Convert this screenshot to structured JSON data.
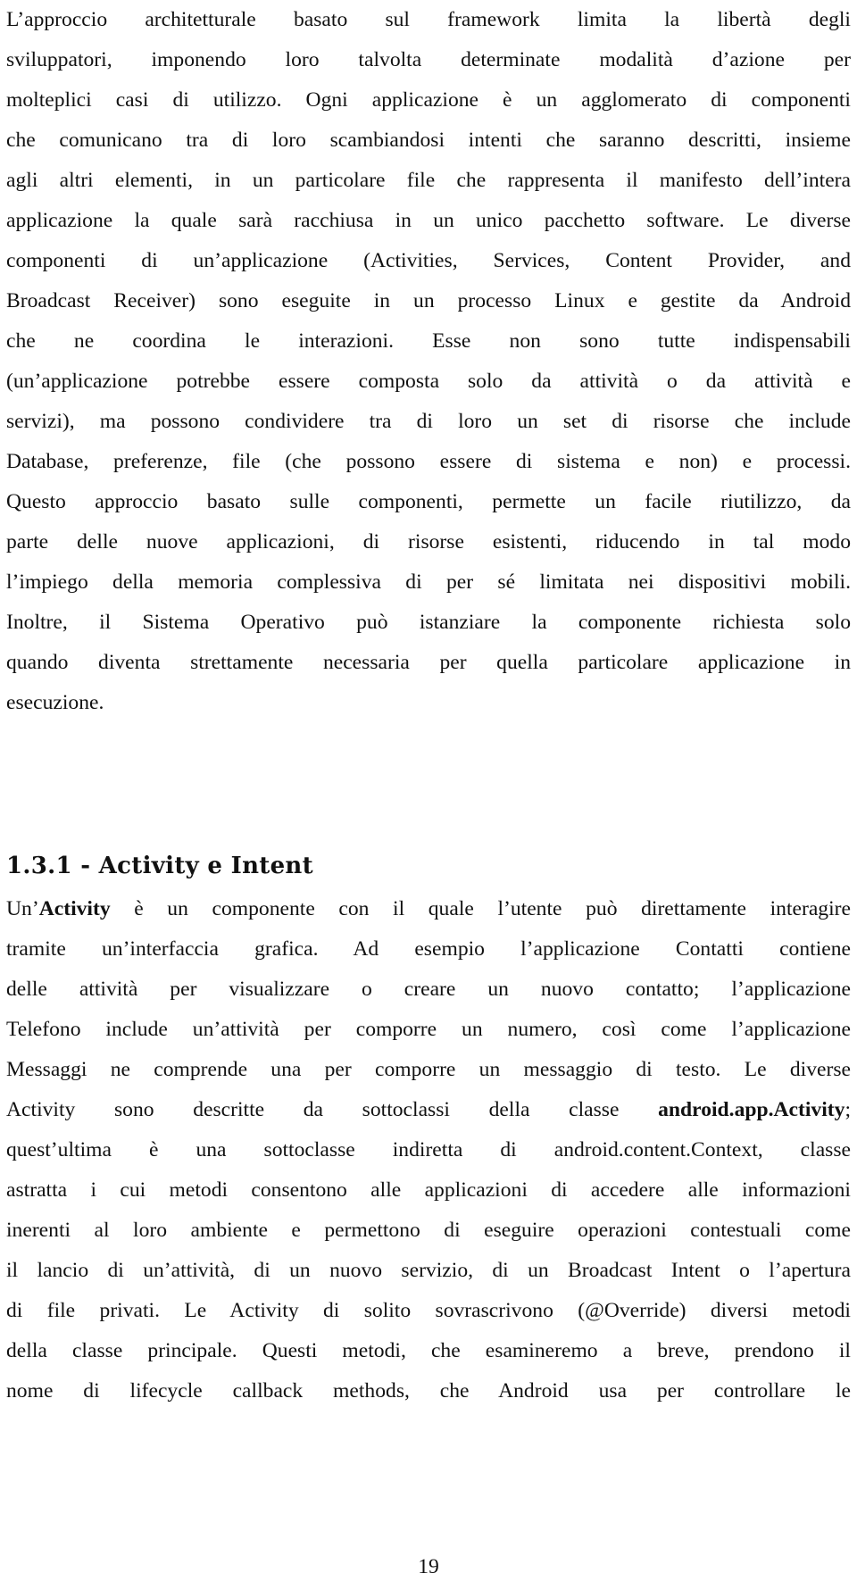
{
  "document": {
    "paragraph_1": [
      "L’approccio architetturale basato sul framework limita la libertà degli",
      "sviluppatori, imponendo loro talvolta determinate modalità d’azione per",
      "molteplici casi di utilizzo. Ogni applicazione è un agglomerato di componenti",
      "che comunicano tra di loro scambiandosi intenti che saranno descritti, insieme",
      "agli altri elementi, in un particolare file che rappresenta il manifesto dell’intera",
      "applicazione la quale sarà racchiusa in un unico pacchetto software. Le diverse",
      "componenti di un’applicazione (Activities, Services, Content Provider, and",
      "Broadcast Receiver) sono eseguite in un processo Linux e gestite da Android",
      "che ne coordina le interazioni. Esse non sono tutte indispensabili",
      "(un’applicazione potrebbe essere composta solo da attività o da attività e",
      "servizi), ma possono condividere tra di loro un set di risorse che include",
      "Database, preferenze, file (che possono essere di sistema e non) e processi.",
      "Questo approccio basato sulle componenti, permette un facile riutilizzo, da",
      "parte delle nuove applicazioni, di risorse esistenti, riducendo in tal modo",
      "l’impiego della memoria complessiva di per sé limitata nei dispositivi mobili.",
      "Inoltre, il Sistema Operativo può istanziare la componente richiesta solo",
      "quando diventa strettamente necessaria per quella particolare applicazione in",
      "esecuzione."
    ],
    "section_heading": "1.3.1 - Activity e Intent",
    "paragraph_2": {
      "line_0": {
        "prefix": "Un’",
        "bold": "Activity",
        "suffix": " è un componente con il quale l’utente può direttamente interagire"
      },
      "lines": [
        "tramite un’interfaccia grafica. Ad esempio l’applicazione Contatti contiene",
        "delle attività per visualizzare o creare un nuovo contatto; l’applicazione",
        "Telefono include un’attività per comporre un numero, così come l’applicazione",
        "Messaggi ne comprende una per comporre un messaggio di testo. Le diverse"
      ],
      "line_5": {
        "prefix": "Activity sono descritte da sottoclassi della classe ",
        "bold": "android.app.Activity",
        "suffix": ";"
      },
      "lines_after": [
        "quest’ultima è una sottoclasse indiretta di android.content.Context, classe",
        "astratta i cui metodi consentono alle applicazioni di accedere alle informazioni",
        "inerenti al loro ambiente e permettono di eseguire operazioni contestuali come",
        "il lancio di un’attività, di un nuovo servizio, di un Broadcast Intent o l’apertura",
        "di file privati. Le Activity di solito sovrascrivono (@Override) diversi metodi",
        "della classe principale. Questi metodi, che esamineremo a breve, prendono il",
        "nome di lifecycle callback methods, che Android usa per controllare le"
      ]
    },
    "page_number": "19"
  }
}
